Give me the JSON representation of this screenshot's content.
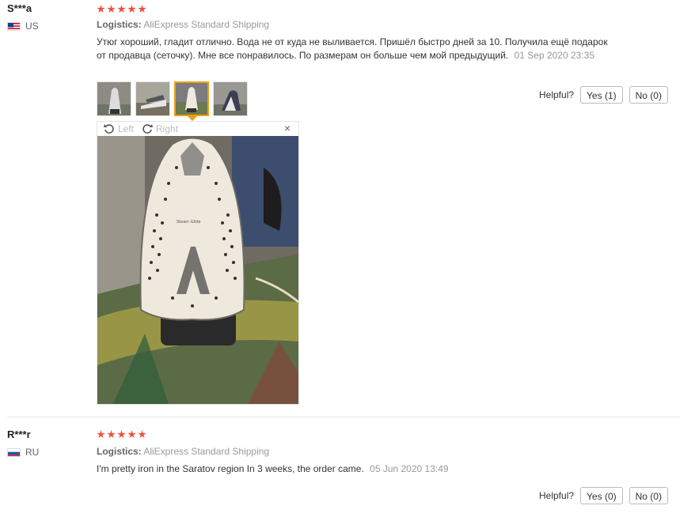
{
  "reviews": [
    {
      "user": "S***a",
      "country": "US",
      "logistics_label": "Logistics:",
      "logistics_value": "AliExpress Standard Shipping",
      "feedback": "Утюг хороший, гладит отлично. Вода не от куда не выливается. Пришёл быстро дней за 10. Получила ещё подарок от продавца (сеточку). Мне все понравилось. По размерам он больше чем мой предыдущий.",
      "date": "01 Sep 2020 23:35",
      "helpful_label": "Helpful?",
      "yes_label": "Yes (1)",
      "no_label": "No (0)",
      "viewer": {
        "left_label": "Left",
        "right_label": "Right",
        "close": "×"
      }
    },
    {
      "user": "R***r",
      "country": "RU",
      "logistics_label": "Logistics:",
      "logistics_value": "AliExpress Standard Shipping",
      "feedback": "I'm pretty iron in the Saratov region In 3 weeks, the order came.",
      "date": "05 Jun 2020 13:49",
      "helpful_label": "Helpful?",
      "yes_label": "Yes (0)",
      "no_label": "No (0)"
    }
  ],
  "rating": 5,
  "colors": {
    "star": "#f0513e",
    "active_thumb": "#f39c12"
  }
}
